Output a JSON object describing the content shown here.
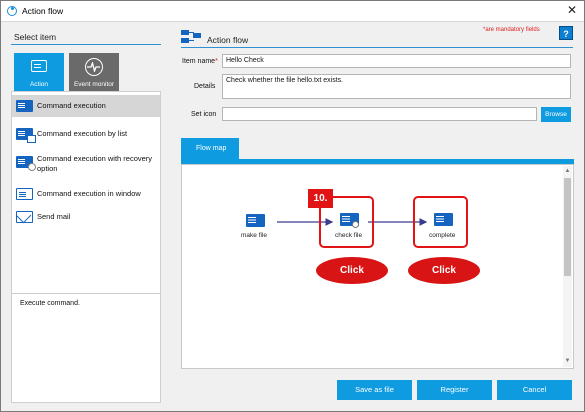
{
  "window": {
    "title": "Action flow",
    "close_glyph": "✕"
  },
  "left": {
    "header": "Select item",
    "tabs": [
      {
        "label": "Action",
        "icon": "command-icon"
      },
      {
        "label": "Event monitor",
        "icon": "heartbeat-icon"
      }
    ],
    "items": [
      {
        "label": "Command execution",
        "icon": "command-icon",
        "selected": true
      },
      {
        "label": "Command execution by list",
        "icon": "command-list-icon"
      },
      {
        "label": "Command execution with recovery option",
        "icon": "command-recovery-icon"
      },
      {
        "label": "Command execution in window",
        "icon": "command-window-icon"
      },
      {
        "label": "Send mail",
        "icon": "mail-icon"
      }
    ],
    "description": "Execute command."
  },
  "right": {
    "title": "Action flow",
    "mandatory_note": "*are mandatory fields",
    "help_label": "?",
    "item_name_label": "Item name",
    "required_mark": "*",
    "item_name_value": "Hello Check",
    "details_label": "Details",
    "details_value": "Check whether the file hello.txt exists.",
    "set_icon_label": "Set icon",
    "set_icon_value": "",
    "browse_label": "Browse",
    "flowmap_tab": "Flow map",
    "nodes": [
      {
        "label": "make file"
      },
      {
        "label": "check file"
      },
      {
        "label": "complete"
      }
    ],
    "step_badge": "10.",
    "click_labels": [
      "Click",
      "Click"
    ],
    "scroll_up": "▲",
    "scroll_down": "▼"
  },
  "buttons": {
    "save_as_file": "Save as file",
    "register": "Register",
    "cancel": "Cancel"
  },
  "colors": {
    "accent": "#0e9be0",
    "highlight": "#e01414",
    "icon": "#1565c0"
  }
}
